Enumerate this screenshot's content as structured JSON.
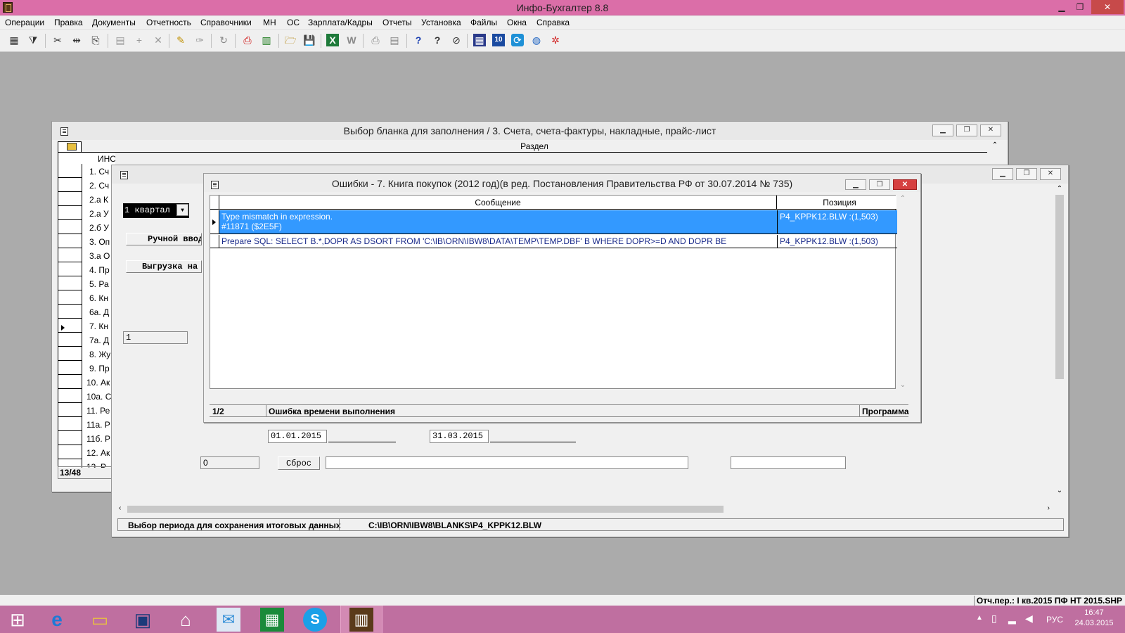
{
  "app": {
    "title": "Инфо-Бухгалтер 8.8",
    "controls": [
      "▁",
      "❐",
      "✕"
    ]
  },
  "menu": [
    "Операции",
    "Правка",
    "Документы",
    "Отчетность",
    "Справочники",
    "МН",
    "ОС",
    "Зарплата/Кадры",
    "Отчеты",
    "Установка",
    "Файлы",
    "Окна",
    "Справка"
  ],
  "toolbar_icons": [
    "grid-icon",
    "filter-icon",
    "cut-icon",
    "move-icon",
    "copy-icon",
    "calc-icon",
    "add-icon",
    "delete-icon",
    "pencil-icon",
    "brush-icon",
    "refresh-icon",
    "pdf-icon",
    "calculator-icon",
    "open-folder-icon",
    "save-icon",
    "excel-icon",
    "word-icon",
    "print-icon",
    "preview-icon",
    "help-icon",
    "whats-this-icon",
    "compass-icon",
    "apps-icon",
    "ib10-icon",
    "teamviewer-icon",
    "globe-icon",
    "network-icon"
  ],
  "toolbar_glyphs": [
    "▦",
    "⧩",
    "✂",
    "⇹",
    "⎘",
    "▤",
    "+",
    "✕",
    "✎",
    "✑",
    "↻",
    "⎙",
    "▥",
    "🗁",
    "💾",
    "X",
    "W",
    "⎙",
    "▤",
    "?",
    "?",
    "⊘",
    "▦",
    "10",
    "⟳",
    "◍",
    "✲"
  ],
  "win_blank": {
    "title": "Выбор бланка для заполнения /     3. Счета, счета-фактуры, накладные, прайс-лист",
    "column": "Раздел",
    "rows": [
      "ИНСТРУКЦИЯ",
      "1. Сч",
      "2. Сч",
      "2.а К",
      "2.а У",
      "2.б У",
      "3. Оп",
      "3.а О",
      "4. Пр",
      "5. Ра",
      "6. Кн",
      "6а. Д",
      "7. Кн",
      "7а. Д",
      "8. Жу",
      "9. Пр",
      "10. Ак",
      "10а. С",
      "11. Ре",
      "11а. Р",
      "11б. Р",
      "12. Ак",
      "13. Р"
    ],
    "counter": "13/48"
  },
  "win_form": {
    "period_value": "1 квартал",
    "btn_manual": "Ручной ввод",
    "btn_upload": "Выгрузка на",
    "num_field": "1",
    "date_from": "01.01.2015",
    "date_to": "31.03.2015",
    "zero_field": "0",
    "reset_label": "Сброс",
    "status_left": "Выбор периода для сохранения итоговых данных",
    "status_path": "C:\\IB\\ORN\\IBW8\\BLANKS\\P4_KPPK12.BLW"
  },
  "win_errors": {
    "title": "Ошибки -   7. Книга покупок (2012 год)(в ред. Постановления Правительства РФ от 30.07.2014 № 735)",
    "col_message": "Сообщение",
    "col_position": "Позиция",
    "rows": [
      {
        "line1": "Type mismatch in expression.",
        "line2": "#11871 ($2E5F)",
        "position": "P4_KPPK12.BLW :(1,503)"
      },
      {
        "line1": "Prepare SQL: SELECT  B.*,DOPR AS DSORT FROM 'C:\\IB\\ORN\\IBW8\\DATA\\TEMP\\TEMP.DBF' B WHERE DOPR>=D AND DOPR BE",
        "line2": "",
        "position": "P4_KPPK12.BLW :(1,503)"
      }
    ],
    "status_count": "1/2",
    "status_text": "Ошибка времени выполнения",
    "status_right": "Программа"
  },
  "bottom_status": "Отч.пер.: I кв.2015  ПФ НТ 2015.SHP",
  "taskbar": {
    "lang": "РУС",
    "time": "16:47",
    "date": "24.03.2015",
    "icons": [
      "windows-icon",
      "ie-icon",
      "explorer-icon",
      "lenovo-icon",
      "home-icon",
      "store-bag-icon",
      "store-icon",
      "skype-icon",
      "infobuh-icon"
    ],
    "glyphs": [
      "⊞",
      "e",
      "▭",
      "▣",
      "⌂",
      "✉",
      "▦",
      "S",
      "▥"
    ]
  },
  "colors": {
    "titlebar": "#db6ea8",
    "selection": "#3399ff",
    "taskbar": "#bf6fa0"
  }
}
